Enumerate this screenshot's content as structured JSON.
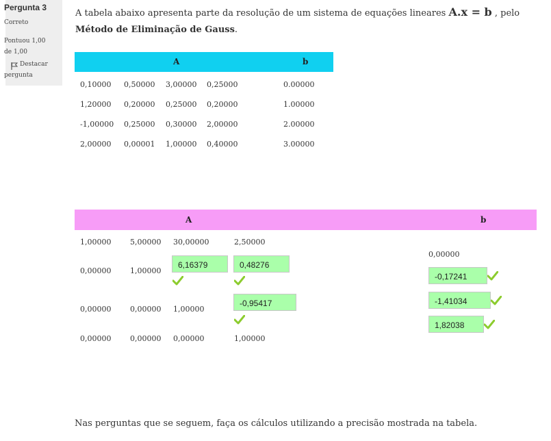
{
  "question": {
    "number_label": "Pergunta 3",
    "state": "Correto",
    "grade": "Pontuou 1,00 de 1,00",
    "flag_label_1": "Destacar",
    "flag_label_2": "pergunta",
    "flag_icon": "flag-icon"
  },
  "intro": {
    "text_before": "A tabela abaixo apresenta parte da resolução de um sistema de equações lineares ",
    "equation": "A.x = b",
    "text_middle": " , pelo ",
    "method": "Método de Eliminação de Gauss",
    "text_end": "."
  },
  "table1": {
    "header_A": "A",
    "header_b": "b",
    "header_color": "#10d0f0",
    "rows": [
      {
        "A": [
          "0,10000",
          "0,50000",
          "3,00000",
          "0,25000"
        ],
        "b": "0.00000"
      },
      {
        "A": [
          "1,20000",
          "0,20000",
          "0,25000",
          "0,20000"
        ],
        "b": "1.00000"
      },
      {
        "A": [
          "-1,00000",
          "0,25000",
          "0,30000",
          "2,00000"
        ],
        "b": "2.00000"
      },
      {
        "A": [
          "2,00000",
          "0,00001",
          "1,00000",
          "0,40000"
        ],
        "b": "3.00000"
      }
    ]
  },
  "table2": {
    "header_A": "A",
    "header_b": "b",
    "header_color": "#f79cf7",
    "static": {
      "r1": [
        "1,00000",
        "5,00000",
        "30,00000",
        "2,50000"
      ],
      "r2": [
        "0,00000",
        "1,00000"
      ],
      "r3": [
        "0,00000",
        "0,00000",
        "1,00000"
      ],
      "r4": [
        "0,00000",
        "0,00000",
        "0,00000",
        "1,00000"
      ],
      "b1": "0,00000"
    },
    "answers": {
      "a23": "6,16379",
      "a24": "0,48276",
      "a34": "-0,95417",
      "b2": "-0,17241",
      "b3": "-1,41034",
      "b4": "1,82038"
    },
    "answer_bg": "#aaffaa",
    "check_color": "#8ccc2e",
    "check_icon": "checkmark-icon"
  },
  "footer": "Nas perguntas que se seguem, faça os cálculos utilizando a precisão mostrada na tabela."
}
